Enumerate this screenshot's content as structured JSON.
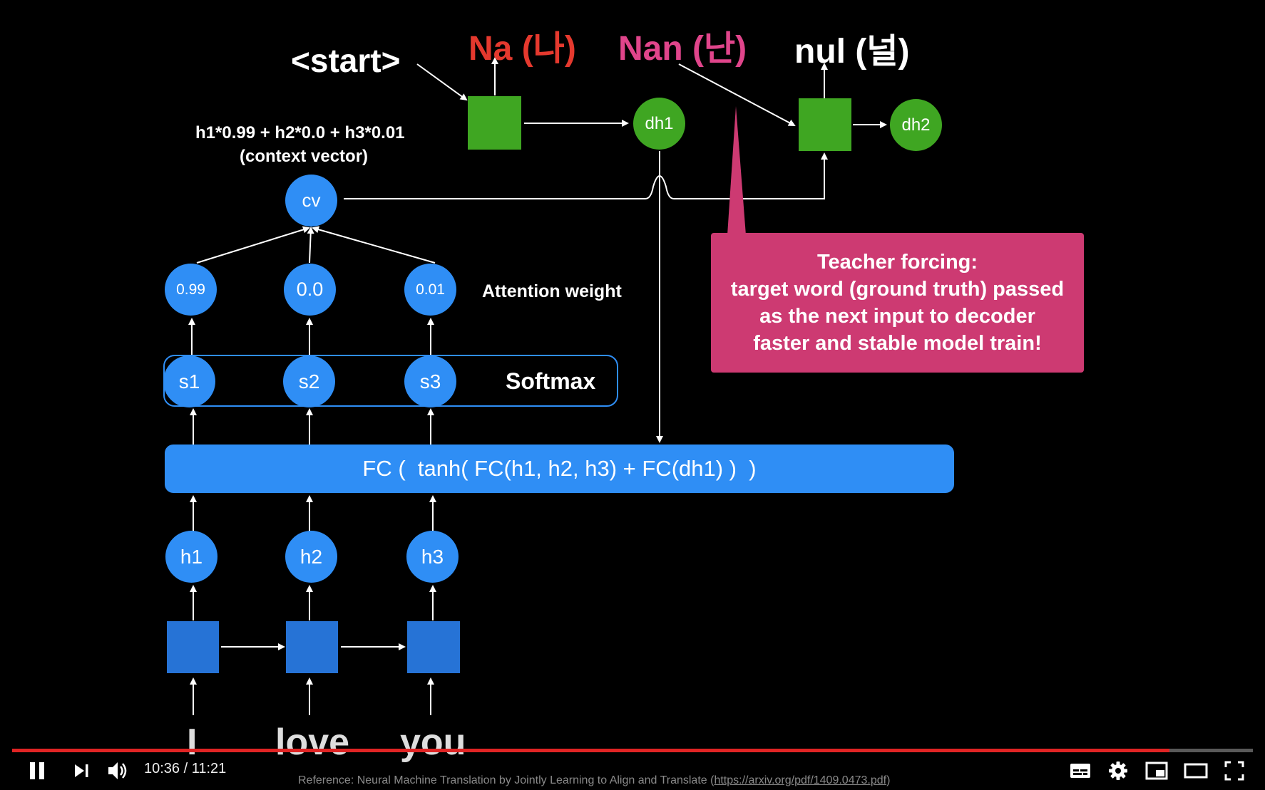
{
  "outputs": {
    "na": "Na (나)",
    "nan": "Nan (난)",
    "nul": "nul (널)",
    "start": "<start>",
    "na_color": "#e5392e",
    "nan_color": "#e0458b",
    "nul_color": "#ffffff"
  },
  "decoder": {
    "dh1": "dh1",
    "dh2": "dh2"
  },
  "context": {
    "formula": "h1*0.99 + h2*0.0 + h3*0.01",
    "caption": "(context vector)",
    "cv": "cv"
  },
  "attention": {
    "weights": [
      "0.99",
      "0.0",
      "0.01"
    ],
    "label": "Attention weight"
  },
  "softmax": {
    "scores": [
      "s1",
      "s2",
      "s3"
    ],
    "label": "Softmax"
  },
  "fc": {
    "formula": "FC (  tanh( FC(h1, h2, h3) + FC(dh1) )  )"
  },
  "encoder": {
    "hidden": [
      "h1",
      "h2",
      "h3"
    ],
    "words": [
      "I",
      "love",
      "you"
    ]
  },
  "teacher": {
    "lines": [
      "Teacher forcing:",
      "target word (ground truth) passed",
      "as the next input to decoder",
      "faster and stable model train!"
    ]
  },
  "player": {
    "time": "10:36 / 11:21",
    "progress": 0.933,
    "reference_prefix": "Reference: Neural Machine Translation by Jointly Learning to Align and Translate (",
    "reference_link": "https://arxiv.org/pdf/1409.0473.pdf",
    "reference_suffix": ")",
    "icons": [
      "pause-icon",
      "next-icon",
      "volume-icon",
      "subtitles-icon",
      "settings-icon",
      "miniplayer-icon",
      "theater-icon",
      "fullscreen-icon"
    ]
  },
  "colors": {
    "blue": "#2f8ef5",
    "green": "#3fa622",
    "magenta": "#cd3a72",
    "progress": "#e02424"
  }
}
